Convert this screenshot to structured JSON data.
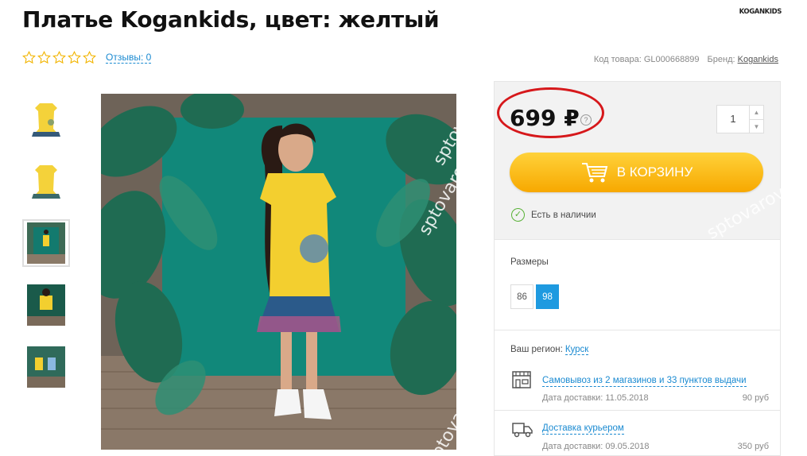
{
  "product": {
    "title": "Платье Kogankids, цвет: желтый",
    "brand_logo": "KOGANKIDS",
    "reviews_label": "Отзывы: 0",
    "rating_stars": 0,
    "rating_max": 5,
    "code_label": "Код товара:",
    "code_value": "GL000668899",
    "brand_label": "Бренд:",
    "brand_value": "Kogankids"
  },
  "gallery": {
    "thumbnails": [
      "thumb-1",
      "thumb-2",
      "thumb-3",
      "thumb-4",
      "thumb-5"
    ],
    "active_index": 2,
    "watermark": "sptovarov.ru"
  },
  "buy": {
    "price": "699 ₽",
    "price_help_icon": "question-icon",
    "quantity": "1",
    "cart_label": "В КОРЗИНУ",
    "cart_icon": "cart-icon",
    "stock_text": "Есть в наличии"
  },
  "sizes": {
    "label": "Размеры",
    "options": [
      "86",
      "98"
    ],
    "selected": "98"
  },
  "delivery": {
    "region_label": "Ваш регион:",
    "region_city": "Курск",
    "options": [
      {
        "icon": "store-icon",
        "title": "Самовывоз из 2 магазинов и 33 пунктов выдачи",
        "date": "Дата доставки: 11.05.2018",
        "price": "90 руб"
      },
      {
        "icon": "truck-icon",
        "title": "Доставка курьером",
        "date": "Дата доставки: 09.05.2018",
        "price": "350 руб"
      }
    ]
  },
  "colors": {
    "accent_blue": "#1e9ae0",
    "cart_yellow": "#f7a800",
    "stock_green": "#58b136",
    "highlight_red": "#d6181b"
  }
}
